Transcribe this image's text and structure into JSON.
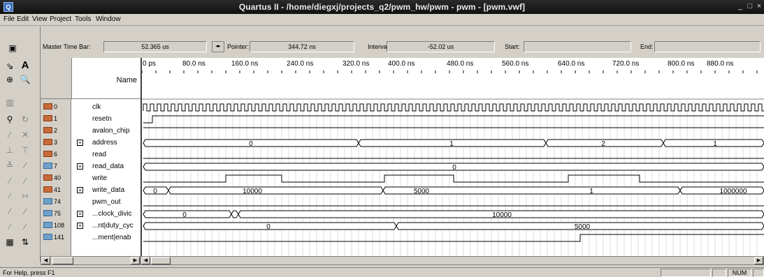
{
  "titlebar": {
    "title": "Quartus II - /home/diegxj/projects_q2/pwm_hw/pwm - pwm - [pwm.vwf]",
    "app_icon": "Q",
    "minimize": "_",
    "restore": "□",
    "close": "×"
  },
  "menu": {
    "items": [
      "File",
      "Edit",
      "View",
      "Project",
      "Tools",
      "Window"
    ]
  },
  "timebar": {
    "master_time_bar_label": "Master Time Bar:",
    "master_time_bar_value": "52.365 us",
    "pointer_label": "Pointer:",
    "pointer_value": "344.72 ns",
    "interval_label": "Interval:",
    "interval_value": "-52.02 us",
    "start_label": "Start:",
    "start_value": "",
    "end_label": "End:",
    "end_value": ""
  },
  "grid": {
    "name_header": "Name"
  },
  "time_ticks": [
    "0 ps",
    "80.0 ns",
    "160.0 ns",
    "240.0 ns",
    "320.0 ns",
    "400.0 ns",
    "480.0 ns",
    "560.0 ns",
    "640.0 ns",
    "720.0 ns",
    "800.0 ns",
    "880.0 ns"
  ],
  "signals": [
    {
      "index": "0",
      "name": "clk",
      "icon": "input-pin-icon",
      "expandable": false
    },
    {
      "index": "1",
      "name": "resetn",
      "icon": "input-pin-icon",
      "expandable": false
    },
    {
      "index": "2",
      "name": "avalon_chip",
      "icon": "input-pin-icon",
      "expandable": false
    },
    {
      "index": "3",
      "name": "address",
      "icon": "input-pin-icon",
      "expandable": true
    },
    {
      "index": "6",
      "name": "read",
      "icon": "input-pin-icon",
      "expandable": false
    },
    {
      "index": "7",
      "name": "read_data",
      "icon": "output-pin-icon",
      "expandable": true
    },
    {
      "index": "40",
      "name": "write",
      "icon": "input-pin-icon",
      "expandable": false
    },
    {
      "index": "41",
      "name": "write_data",
      "icon": "input-pin-icon",
      "expandable": true
    },
    {
      "index": "74",
      "name": "pwm_out",
      "icon": "output-pin-icon",
      "expandable": false
    },
    {
      "index": "75",
      "name": "...clock_divic",
      "icon": "buried-node-icon",
      "expandable": true
    },
    {
      "index": "108",
      "name": "...nt|duty_cyc",
      "icon": "buried-node-icon",
      "expandable": true
    },
    {
      "index": "141",
      "name": "...ment|enab",
      "icon": "buried-node-icon",
      "expandable": false
    }
  ],
  "bus_values": {
    "address": [
      "0",
      "1",
      "2",
      "1"
    ],
    "read_data": [
      "0"
    ],
    "write_data": [
      "0",
      "10000",
      "5000",
      "1",
      "1000000"
    ],
    "clock_divider": [
      "0",
      "10000"
    ],
    "duty_cycle": [
      "0",
      "5000"
    ]
  },
  "status": {
    "help_text": "For Help, press F1",
    "num": "NUM"
  },
  "colors": {
    "titlebar": "#1a1a1a",
    "wave": "#000000",
    "grid": "#c8c8c8"
  }
}
